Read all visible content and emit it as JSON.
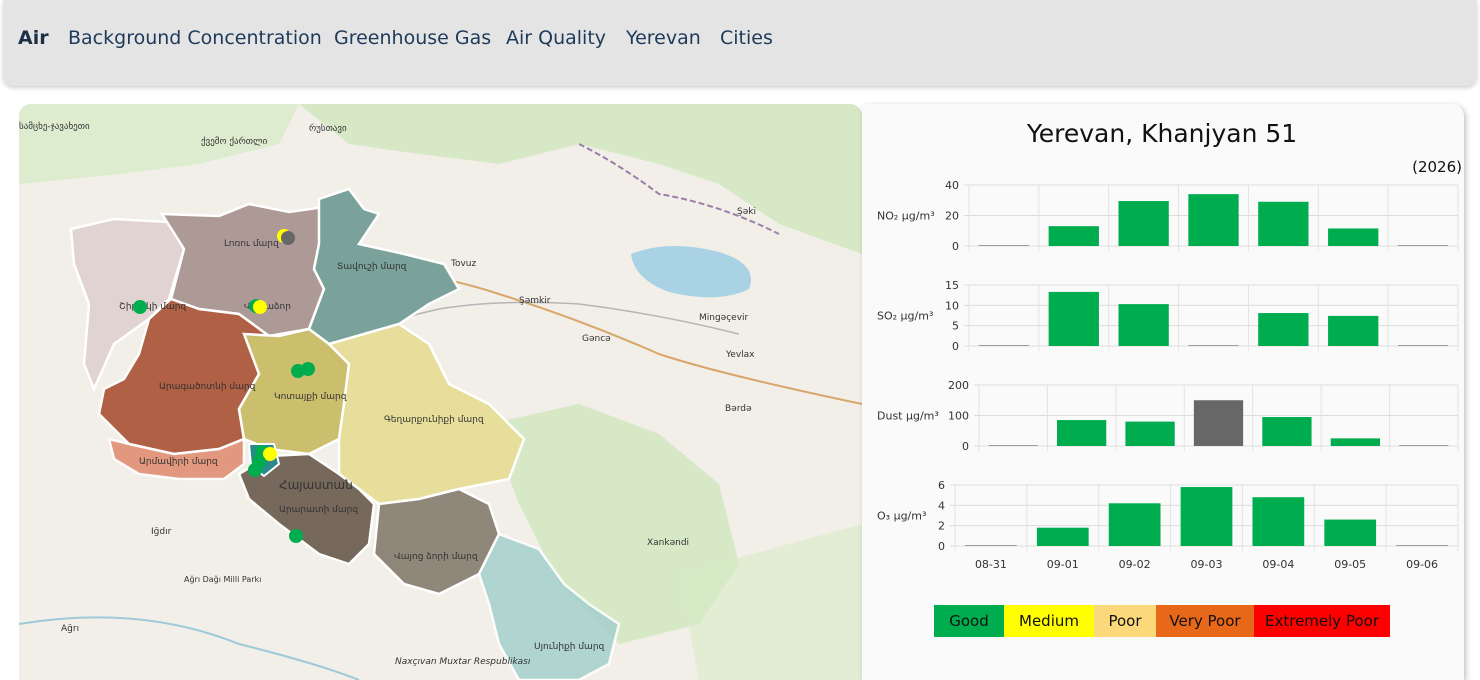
{
  "nav": {
    "items": [
      "Air",
      "Background Concentration",
      "Greenhouse Gas",
      "Air Quality",
      "Yerevan",
      "Cities"
    ],
    "active": "Air"
  },
  "map": {
    "labels": {
      "tbilisi_region": "ქვემო ქართლი",
      "rustavi": "რუსთავი",
      "samtskhe": "სამცხე-ჯავახეთი",
      "lori": "Լոռու մարզ",
      "tavush": "Տավուշի մարզ",
      "vanadzor": "Վանաձոր",
      "shirak": "Շիրակի մարզ",
      "aragatsotn": "Արագածոտնի մարզ",
      "kotayk": "Կոտայքի մարզ",
      "gegharkunik": "Գեղարքունիքի մարզ",
      "armavir": "Արմավիրի մարզ",
      "ararat": "Արարատի մարզ",
      "hayastan": "Հայաստան",
      "vayots": "Վայոց ձորի մարզ",
      "syunik": "Սյունիքի մարզ",
      "tovuz": "Tovuz",
      "shamkir": "Şəmkir",
      "ganja": "Gəncə",
      "mingachevir": "Mingəçevir",
      "yevlax": "Yevlax",
      "barda": "Bərdə",
      "sheki": "Şəki",
      "khankendi": "Xankəndi",
      "igdir": "Iğdır",
      "agri_park": "Ağrı Dağı Milli Parkı",
      "agri": "Ağrı",
      "nakhchivan": "Naxçıvan Muxtar Respublikası"
    }
  },
  "panel": {
    "title": "Yerevan, Khanjyan 51",
    "year": "(2026)"
  },
  "chart_data": {
    "type": "bar",
    "categories": [
      "08-31",
      "09-01",
      "09-02",
      "09-03",
      "09-04",
      "09-05",
      "09-06"
    ],
    "series": [
      {
        "name": "NO₂ µg/m³",
        "ylim": [
          0,
          40
        ],
        "ticks": [
          0,
          20,
          40
        ],
        "values": [
          0,
          13,
          29.5,
          34,
          29,
          11.5,
          0
        ],
        "colors": [
          "#00ad4e",
          "#00ad4e",
          "#00ad4e",
          "#00ad4e",
          "#00ad4e",
          "#00ad4e",
          "#00ad4e"
        ]
      },
      {
        "name": "SO₂ µg/m³",
        "ylim": [
          0,
          15
        ],
        "ticks": [
          0,
          5,
          10,
          15
        ],
        "values": [
          0,
          13.3,
          10.3,
          0,
          8.1,
          7.4,
          0
        ],
        "colors": [
          "#00ad4e",
          "#00ad4e",
          "#00ad4e",
          "#00ad4e",
          "#00ad4e",
          "#00ad4e",
          "#00ad4e"
        ]
      },
      {
        "name": "Dust µg/m³",
        "ylim": [
          0,
          200
        ],
        "ticks": [
          0,
          100,
          200
        ],
        "values": [
          0,
          85,
          80,
          150,
          95,
          25,
          0
        ],
        "colors": [
          "#00ad4e",
          "#00ad4e",
          "#00ad4e",
          "#676767",
          "#00ad4e",
          "#00ad4e",
          "#00ad4e"
        ]
      },
      {
        "name": "O₃ µg/m³",
        "ylim": [
          0,
          6
        ],
        "ticks": [
          0,
          2,
          4,
          6
        ],
        "values": [
          0,
          1.8,
          4.2,
          5.8,
          4.8,
          2.6,
          0
        ],
        "colors": [
          "#00ad4e",
          "#00ad4e",
          "#00ad4e",
          "#00ad4e",
          "#00ad4e",
          "#00ad4e",
          "#00ad4e"
        ]
      }
    ],
    "legend": [
      {
        "label": "Good",
        "color": "#00ad4e"
      },
      {
        "label": "Medium",
        "color": "#ffff00"
      },
      {
        "label": "Poor",
        "color": "#fbd87a"
      },
      {
        "label": "Very Poor",
        "color": "#e8681a"
      },
      {
        "label": "Extremely Poor",
        "color": "#ff0000"
      }
    ],
    "grid": true
  }
}
